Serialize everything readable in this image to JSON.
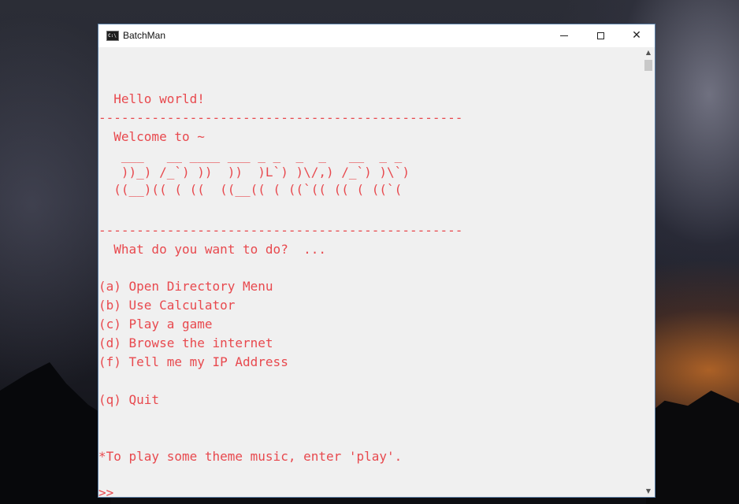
{
  "window": {
    "title": "BatchMan",
    "icon_text": "C:\\",
    "controls": {
      "minimize": "minimize-icon",
      "maximize": "maximize-icon",
      "close_label": "✕"
    }
  },
  "console": {
    "text_color": "#e8494e",
    "background": "#f0f0f0",
    "lines": {
      "hello": "  Hello world!",
      "divider1": "------------------------------------------------",
      "welcome": "  Welcome to ~",
      "art1": "   ___   __ ____ ___ _ _  _  _   __  _ _",
      "art2": "   ))_) /_`) ))  ))  )L`) )\\/,) /_`) )\\`)",
      "art3": "  ((__)(( ( ((  ((__(( ( ((`(( (( ( ((`(",
      "divider2": "------------------------------------------------",
      "question": "  What do you want to do?  ...",
      "opt_a": "(a) Open Directory Menu",
      "opt_b": "(b) Use Calculator",
      "opt_c": "(c) Play a game",
      "opt_d": "(d) Browse the internet",
      "opt_f": "(f) Tell me my IP Address",
      "opt_q": "(q) Quit",
      "music": "*To play some theme music, enter 'play'.",
      "prompt": ">>"
    }
  }
}
